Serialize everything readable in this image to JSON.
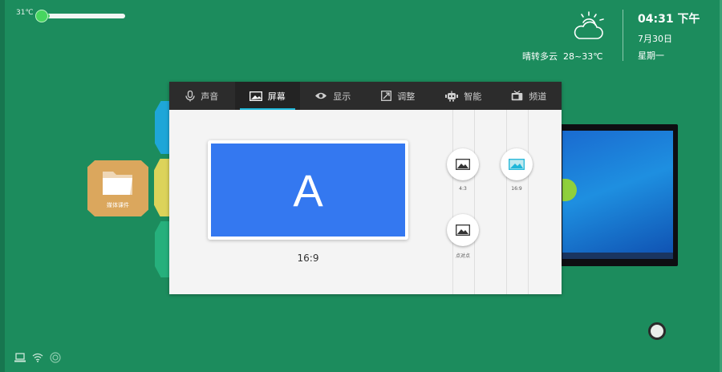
{
  "temperature": {
    "label": "31℃",
    "level_percent": 10
  },
  "weather": {
    "description": "晴转多云",
    "range": "28~33℃",
    "icon": "partly-cloudy-icon"
  },
  "clock": {
    "time": "04:31 下午",
    "date": "7月30日",
    "weekday": "星期一"
  },
  "desktop_tiles": {
    "folder_label": "媒体课件"
  },
  "settings": {
    "tabs": [
      {
        "label": "声音",
        "icon": "microphone-icon"
      },
      {
        "label": "屏幕",
        "icon": "screen-icon"
      },
      {
        "label": "显示",
        "icon": "eye-icon"
      },
      {
        "label": "调整",
        "icon": "adjust-icon"
      },
      {
        "label": "智能",
        "icon": "robot-icon"
      },
      {
        "label": "频道",
        "icon": "tv-icon"
      }
    ],
    "active_tab": "屏幕",
    "preview": {
      "letter": "A",
      "ratio": "16:9"
    },
    "options": [
      {
        "label": "4:3",
        "icon": "image-icon"
      },
      {
        "label": "16:9",
        "icon": "image-icon"
      },
      {
        "label": "点对点",
        "icon": "image-icon"
      }
    ]
  },
  "colors": {
    "background": "#1c8c5d",
    "accent": "#1fb6d9",
    "preview": "#3478f0"
  },
  "status_icons": [
    "laptop-icon",
    "wifi-icon",
    "signal-icon"
  ]
}
